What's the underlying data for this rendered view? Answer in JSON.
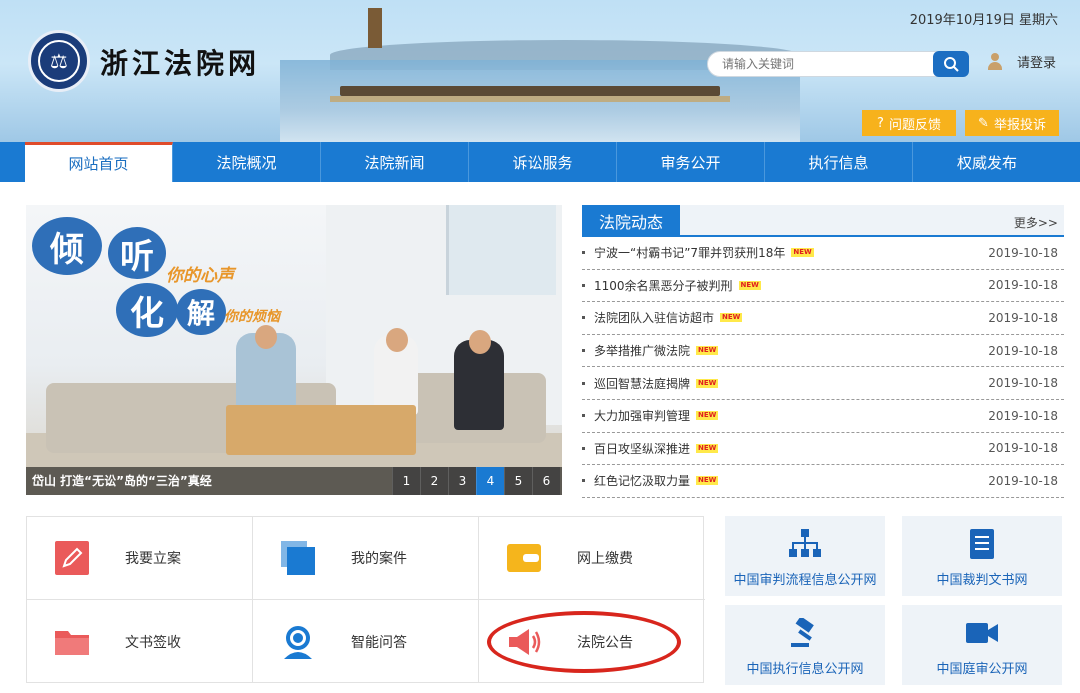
{
  "header": {
    "site_title": "浙江法院网",
    "date": "2019年10月19日 星期六",
    "search_placeholder": "请输入关键词",
    "login_label": "请登录",
    "feedback_label": "问题反馈",
    "report_label": "举报投诉"
  },
  "nav": {
    "items": [
      "网站首页",
      "法院概况",
      "法院新闻",
      "诉讼服务",
      "审务公开",
      "执行信息",
      "权威发布"
    ],
    "active_index": 0
  },
  "slideshow": {
    "slogan_words": [
      "倾",
      "听",
      "化",
      "解"
    ],
    "slogan_1": "你的心声",
    "slogan_2": "你的烦恼",
    "caption": "岱山 打造“无讼”岛的“三治”真经",
    "pages": [
      "1",
      "2",
      "3",
      "4",
      "5",
      "6"
    ],
    "active_page": "4"
  },
  "news": {
    "title": "法院动态",
    "more": "更多>>",
    "new_badge": "NEW",
    "items": [
      {
        "title": "宁波一“村霸书记”7罪并罚获刑18年",
        "date": "2019-10-18"
      },
      {
        "title": "1100余名黑恶分子被判刑",
        "date": "2019-10-18"
      },
      {
        "title": "法院团队入驻信访超市",
        "date": "2019-10-18"
      },
      {
        "title": "多举措推广微法院",
        "date": "2019-10-18"
      },
      {
        "title": "巡回智慧法庭揭牌",
        "date": "2019-10-18"
      },
      {
        "title": "大力加强审判管理",
        "date": "2019-10-18"
      },
      {
        "title": "百日攻坚纵深推进",
        "date": "2019-10-18"
      },
      {
        "title": "红色记忆汲取力量",
        "date": "2019-10-18"
      }
    ]
  },
  "services": [
    {
      "label": "我要立案",
      "icon": "pencil-icon",
      "color": "#ea5a5a"
    },
    {
      "label": "我的案件",
      "icon": "folder-stack-icon",
      "color": "#1a7ad2"
    },
    {
      "label": "网上缴费",
      "icon": "wallet-icon",
      "color": "#f5b51c"
    },
    {
      "label": "文书签收",
      "icon": "folder-icon",
      "color": "#ea5a5a"
    },
    {
      "label": "智能问答",
      "icon": "support-agent-icon",
      "color": "#1a7ad2"
    },
    {
      "label": "法院公告",
      "icon": "megaphone-icon",
      "color": "#ea5a5a"
    }
  ],
  "links": [
    {
      "label": "中国审判流程信息公开网",
      "icon": "org-chart-icon"
    },
    {
      "label": "中国裁判文书网",
      "icon": "document-icon"
    },
    {
      "label": "中国执行信息公开网",
      "icon": "gavel-icon"
    },
    {
      "label": "中国庭审公开网",
      "icon": "video-camera-icon"
    }
  ],
  "colors": {
    "nav_blue": "#1a7ad2",
    "accent_orange": "#f7b21c",
    "highlight_red": "#d8261d"
  }
}
